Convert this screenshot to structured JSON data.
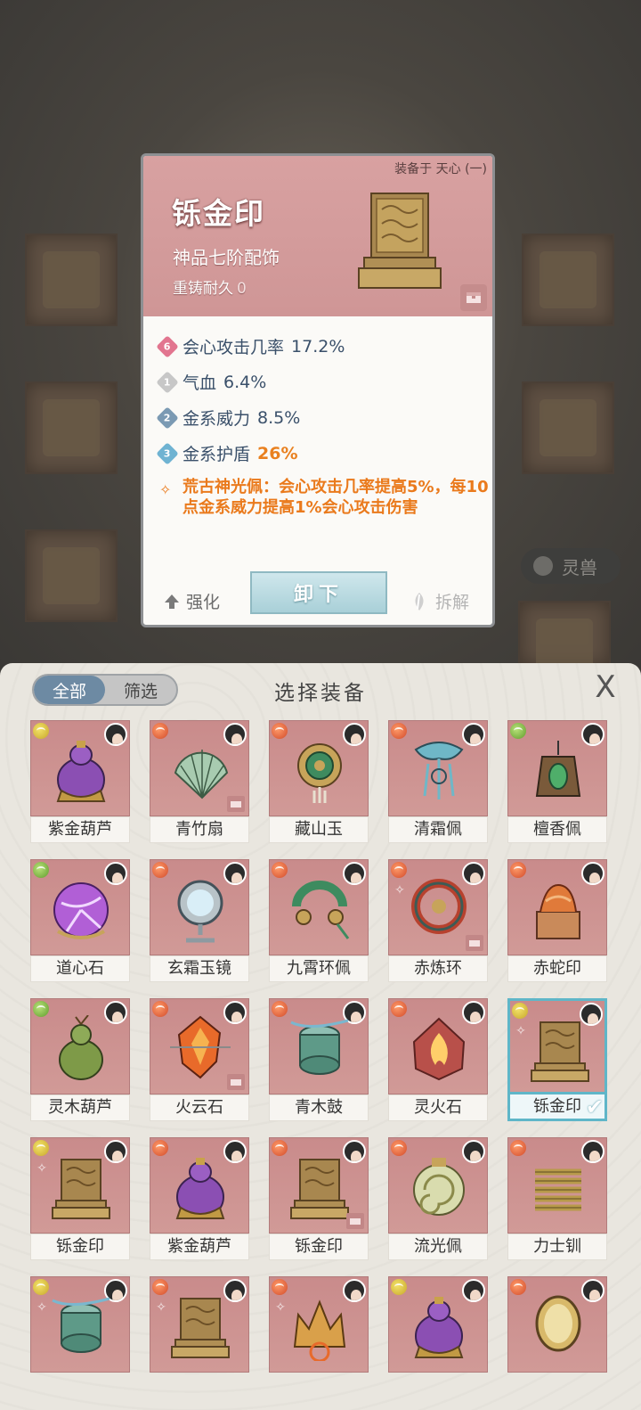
{
  "detail": {
    "equipped_on": "装备于 天心 (一)",
    "name": "铄金印",
    "grade": "神品七阶配饰",
    "durability_label": "重铸耐久",
    "durability_value": "0",
    "stats": [
      {
        "rank": "6",
        "label": "会心攻击几率",
        "value": "17.2%",
        "badge_color": "#e2758f"
      },
      {
        "rank": "1",
        "label": "气血",
        "value": "6.4%",
        "badge_color": "#c7c7c7"
      },
      {
        "rank": "2",
        "label": "金系威力",
        "value": "8.5%",
        "badge_color": "#7b9ab3"
      },
      {
        "rank": "3",
        "label": "金系护盾",
        "value": "26%",
        "badge_color": "#6fb3d2"
      }
    ],
    "effect_text": "荒古神光佩：会心攻击几率提高5%，每10点金系威力提高1%会心攻击伤害",
    "strengthen_label": "强化",
    "unequip_label": "卸下",
    "dismantle_label": "拆解"
  },
  "background": {
    "pill_label": "灵兽"
  },
  "panel": {
    "title": "选择装备",
    "tab_all": "全部",
    "tab_filter": "筛选",
    "close_glyph": "X"
  },
  "items": [
    {
      "name": "紫金葫芦",
      "element": "gold",
      "art": "gourd-purple"
    },
    {
      "name": "青竹扇",
      "element": "fire",
      "art": "fan",
      "chest": true
    },
    {
      "name": "藏山玉",
      "element": "fire",
      "art": "jade-ring"
    },
    {
      "name": "清霜佩",
      "element": "fire",
      "art": "frost-pendant"
    },
    {
      "name": "檀香佩",
      "element": "wood",
      "art": "incense"
    },
    {
      "name": "道心石",
      "element": "wood",
      "art": "orb"
    },
    {
      "name": "玄霜玉镜",
      "element": "fire",
      "art": "mirror"
    },
    {
      "name": "九霄环佩",
      "element": "fire",
      "art": "jade-ring2"
    },
    {
      "name": "赤炼环",
      "element": "fire",
      "art": "red-ring",
      "rank": true,
      "chest": true
    },
    {
      "name": "赤蛇印",
      "element": "fire",
      "art": "snake-seal"
    },
    {
      "name": "灵木葫芦",
      "element": "wood",
      "art": "gourd-green"
    },
    {
      "name": "火云石",
      "element": "fire",
      "art": "fire-stone",
      "chest": true
    },
    {
      "name": "青木鼓",
      "element": "fire",
      "art": "drum"
    },
    {
      "name": "灵火石",
      "element": "fire",
      "art": "flame"
    },
    {
      "name": "铄金印",
      "element": "gold",
      "art": "seal",
      "rank": true,
      "selected": true
    },
    {
      "name": "铄金印",
      "element": "gold",
      "art": "seal",
      "rank": true
    },
    {
      "name": "紫金葫芦",
      "element": "fire",
      "art": "gourd-purple"
    },
    {
      "name": "铄金印",
      "element": "fire",
      "art": "seal",
      "chest": true
    },
    {
      "name": "流光佩",
      "element": "fire",
      "art": "disc"
    },
    {
      "name": "力士钏",
      "element": "fire",
      "art": "spring"
    },
    {
      "name": "",
      "element": "gold",
      "art": "drum",
      "rank": true
    },
    {
      "name": "",
      "element": "fire",
      "art": "seal",
      "rank": true
    },
    {
      "name": "",
      "element": "fire",
      "art": "crown",
      "rank": true
    },
    {
      "name": "",
      "element": "gold",
      "art": "gourd-purple"
    },
    {
      "name": "",
      "element": "fire",
      "art": "mirror-gold"
    }
  ]
}
